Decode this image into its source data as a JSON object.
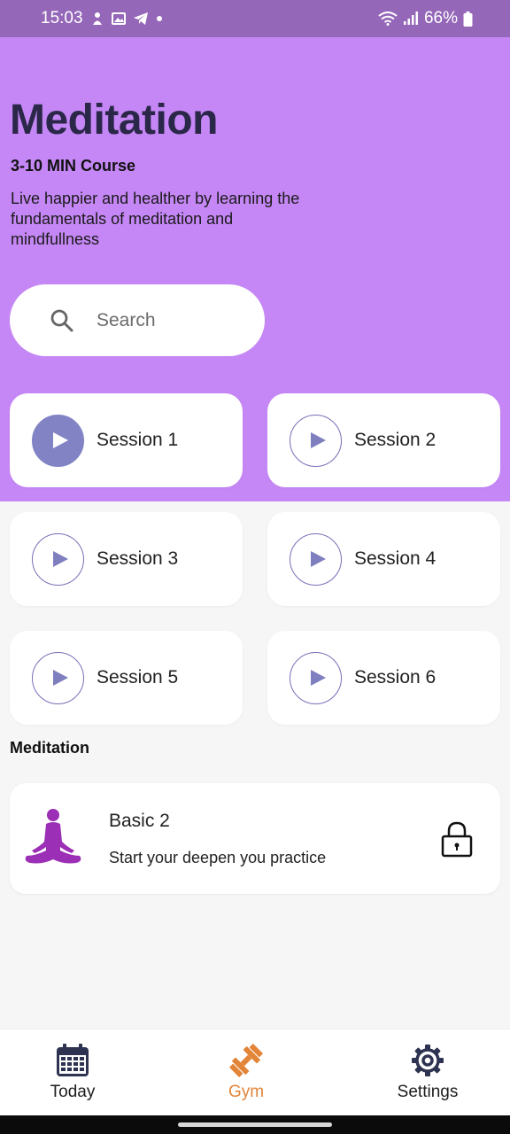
{
  "status_bar": {
    "time": "15:03",
    "battery": "66%"
  },
  "header": {
    "title": "Meditation",
    "subtitle": "3-10 MIN Course",
    "description": "Live happier and healther by learning the fundamentals of meditation and mindfullness"
  },
  "search": {
    "placeholder": "Search"
  },
  "sessions": [
    {
      "label": "Session 1",
      "active": true
    },
    {
      "label": "Session 2",
      "active": false
    },
    {
      "label": "Session 3",
      "active": false
    },
    {
      "label": "Session 4",
      "active": false
    },
    {
      "label": "Session 5",
      "active": false
    },
    {
      "label": "Session 6",
      "active": false
    }
  ],
  "section": {
    "title": "Meditation"
  },
  "course": {
    "title": "Basic 2",
    "subtitle": "Start your deepen you practice",
    "locked": true,
    "icon": "yoga-meditation-icon"
  },
  "nav": {
    "items": [
      {
        "label": "Today",
        "icon": "calendar-icon",
        "active": false
      },
      {
        "label": "Gym",
        "icon": "dumbbell-icon",
        "active": true
      },
      {
        "label": "Settings",
        "icon": "gear-icon",
        "active": false
      }
    ]
  },
  "colors": {
    "hero": "#c587f5",
    "status_bar": "#9567b9",
    "title": "#2a2748",
    "play_active": "#8183c4",
    "nav_active": "#e38539",
    "yoga_icon": "#9b2fb5"
  }
}
